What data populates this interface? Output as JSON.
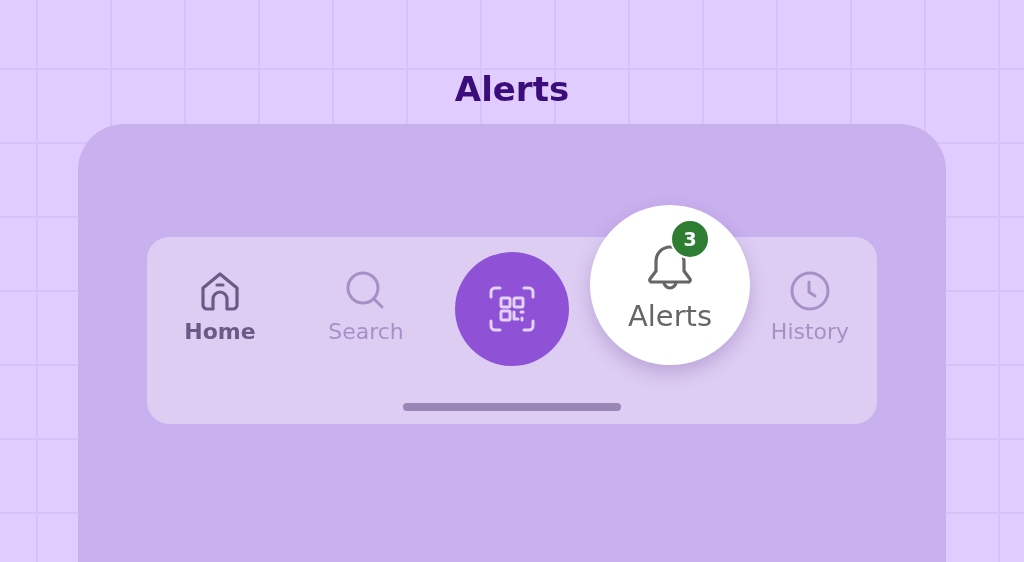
{
  "title": "Alerts",
  "nav": {
    "items": [
      {
        "kind": "tab",
        "label": "Home",
        "selected": true,
        "magnified": false
      },
      {
        "kind": "tab",
        "label": "Search",
        "selected": false,
        "magnified": false
      },
      {
        "kind": "action"
      },
      {
        "kind": "tab",
        "label": "Alerts",
        "selected": false,
        "magnified": true,
        "badge": "3"
      },
      {
        "kind": "tab",
        "label": "History",
        "selected": false,
        "magnified": false
      }
    ]
  }
}
